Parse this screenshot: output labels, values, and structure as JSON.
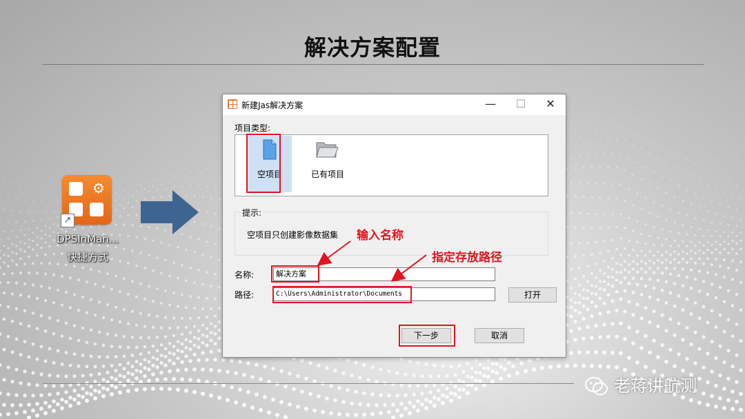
{
  "slide": {
    "title": "解决方案配置",
    "watermark": "老蒋讲航测"
  },
  "shortcut": {
    "name": "DPSInMan...",
    "type": "快捷方式",
    "icon": "app-grid-gear-icon"
  },
  "dialog": {
    "title": "新建Jas解决方案",
    "icon": "app-grid-icon",
    "window_buttons": {
      "minimize": "—",
      "maximize": "☐",
      "close": "✕"
    },
    "project_type_label": "项目类型:",
    "project_types": [
      {
        "label": "空项目",
        "icon": "blank-document-icon",
        "selected": true
      },
      {
        "label": "已有项目",
        "icon": "open-folder-icon",
        "selected": false
      }
    ],
    "hint_label": "提示:",
    "hint_text": "空项目只创建影像数据集",
    "name_label": "名称:",
    "name_value": "解决方案",
    "path_label": "路径:",
    "path_value": "C:\\Users\\Administrator\\Documents",
    "open_button": "打开",
    "next_button": "下一步",
    "cancel_button": "取消"
  },
  "annotations": {
    "enter_name": "输入名称",
    "specify_path": "指定存放路径",
    "color": "#e0141e"
  },
  "colors": {
    "accent_orange": "#e8742a",
    "arrow_blue": "#3e6491",
    "highlight_red": "#e0141e"
  }
}
